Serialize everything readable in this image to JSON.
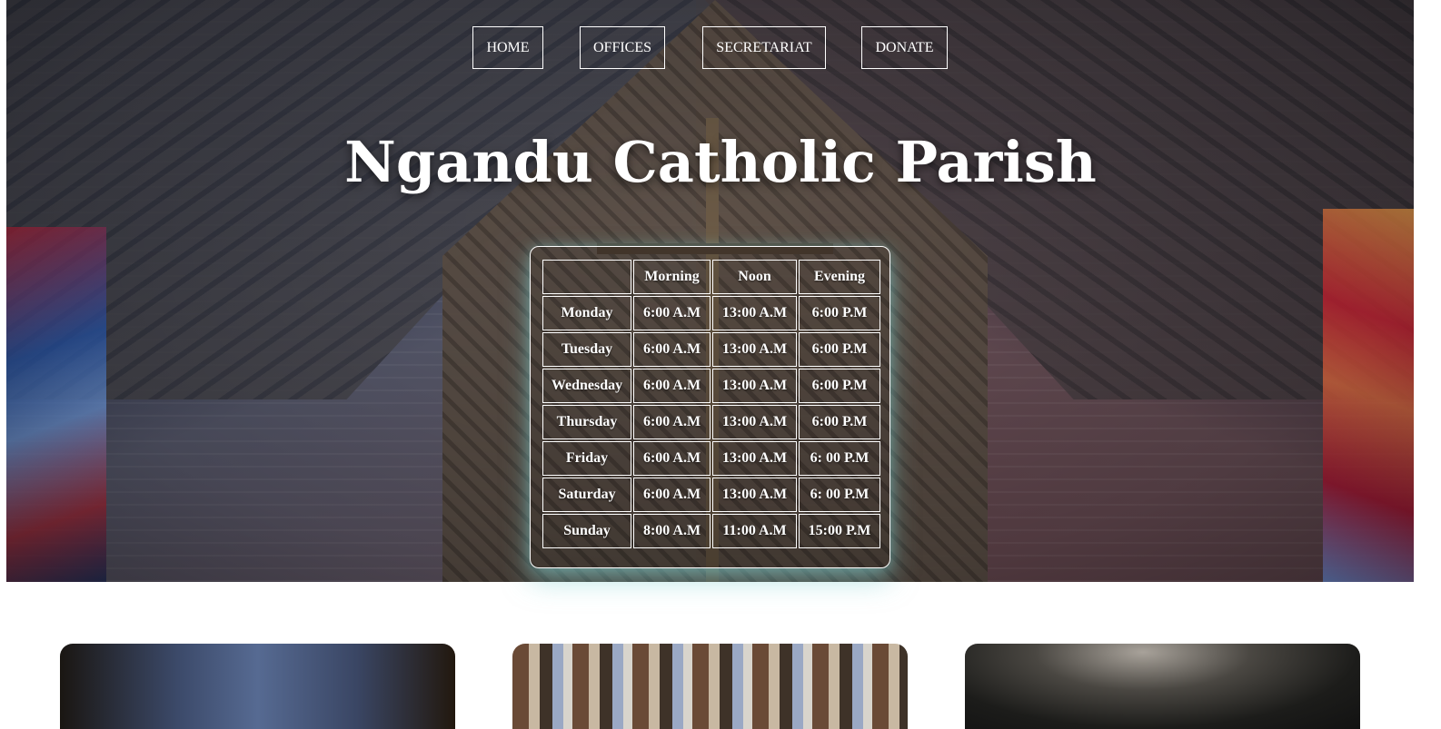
{
  "nav": {
    "items": [
      {
        "label": "HOME"
      },
      {
        "label": "OFFICES"
      },
      {
        "label": "SECRETARIAT"
      },
      {
        "label": "DONATE"
      }
    ]
  },
  "hero": {
    "title": "Ngandu Catholic Parish"
  },
  "schedule": {
    "headers": [
      "",
      "Morning",
      "Noon",
      "Evening"
    ],
    "rows": [
      {
        "day": "Monday",
        "morning": "6:00 A.M",
        "noon": "13:00 A.M",
        "evening": "6:00 P.M"
      },
      {
        "day": "Tuesday",
        "morning": "6:00 A.M",
        "noon": "13:00 A.M",
        "evening": "6:00 P.M"
      },
      {
        "day": "Wednesday",
        "morning": "6:00 A.M",
        "noon": "13:00 A.M",
        "evening": "6:00 P.M"
      },
      {
        "day": "Thursday",
        "morning": "6:00 A.M",
        "noon": "13:00 A.M",
        "evening": "6:00 P.M"
      },
      {
        "day": "Friday",
        "morning": "6:00 A.M",
        "noon": "13:00 A.M",
        "evening": "6: 00 P.M"
      },
      {
        "day": "Saturday",
        "morning": "6:00 A.M",
        "noon": "13:00 A.M",
        "evening": "6: 00 P.M"
      },
      {
        "day": "Sunday",
        "morning": "8:00 A.M",
        "noon": "11:00 A.M",
        "evening": "15:00 P.M"
      }
    ]
  },
  "colors": {
    "text": "#ffffff",
    "page_background": "#ffffff",
    "table_glow": "#82d2d2"
  }
}
